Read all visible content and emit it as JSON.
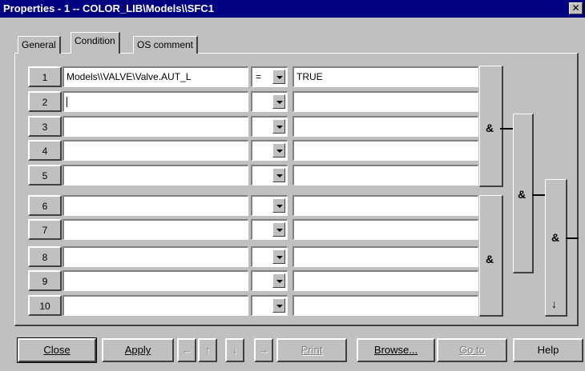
{
  "window": {
    "title": "Properties - 1 -- COLOR_LIB\\Models\\\\SFC1",
    "close_glyph": "✕"
  },
  "tabs": [
    {
      "label": "General"
    },
    {
      "label": "Condition"
    },
    {
      "label": "OS comment"
    }
  ],
  "rows": [
    {
      "num": "1",
      "expression": "Models\\\\VALVE\\Valve.AUT_L",
      "operator": "=",
      "value": "TRUE"
    },
    {
      "num": "2",
      "expression": "",
      "operator": "",
      "value": ""
    },
    {
      "num": "3",
      "expression": "",
      "operator": "",
      "value": ""
    },
    {
      "num": "4",
      "expression": "",
      "operator": "",
      "value": ""
    },
    {
      "num": "5",
      "expression": "",
      "operator": "",
      "value": ""
    },
    {
      "num": "6",
      "expression": "",
      "operator": "",
      "value": ""
    },
    {
      "num": "7",
      "expression": "",
      "operator": "",
      "value": ""
    },
    {
      "num": "8",
      "expression": "",
      "operator": "",
      "value": ""
    },
    {
      "num": "9",
      "expression": "",
      "operator": "",
      "value": ""
    },
    {
      "num": "10",
      "expression": "",
      "operator": "",
      "value": ""
    }
  ],
  "gates": {
    "and_symbol": "&",
    "down_arrow": "↓"
  },
  "buttons": {
    "close": "Close",
    "apply": "Apply",
    "arrow_left": "←",
    "arrow_up": "↑",
    "arrow_down": "↓",
    "arrow_right": "→",
    "print": "Print",
    "browse": "Browse...",
    "goto": "Go to",
    "help": "Help"
  }
}
